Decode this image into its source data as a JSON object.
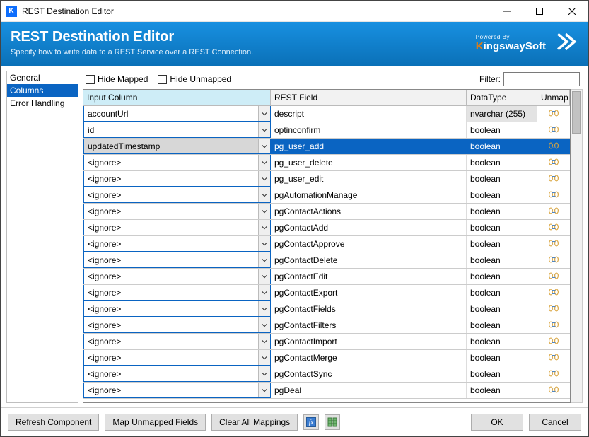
{
  "window": {
    "title": "REST Destination Editor"
  },
  "header": {
    "title": "REST Destination Editor",
    "subtitle": "Specify how to write data to a REST Service over a REST Connection.",
    "powered_by": "Powered By",
    "brand_k": "K",
    "brand_rest": "ingswaySoft"
  },
  "sidebar": {
    "items": [
      {
        "label": "General",
        "selected": false
      },
      {
        "label": "Columns",
        "selected": true
      },
      {
        "label": "Error Handling",
        "selected": false
      }
    ]
  },
  "toolbar": {
    "hide_mapped": "Hide Mapped",
    "hide_unmapped": "Hide Unmapped",
    "filter_label": "Filter:",
    "filter_value": ""
  },
  "grid": {
    "headers": {
      "input": "Input Column",
      "rest": "REST Field",
      "type": "DataType",
      "unmap": "Unmap"
    },
    "rows": [
      {
        "input": "accountUrl",
        "rest": "descript",
        "type": "nvarchar (255)",
        "type_shaded": true,
        "selected": false
      },
      {
        "input": "id",
        "rest": "optinconfirm",
        "type": "boolean",
        "selected": false
      },
      {
        "input": "updatedTimestamp",
        "rest": "pg_user_add",
        "type": "boolean",
        "selected": true
      },
      {
        "input": "<ignore>",
        "rest": "pg_user_delete",
        "type": "boolean",
        "selected": false
      },
      {
        "input": "<ignore>",
        "rest": "pg_user_edit",
        "type": "boolean",
        "selected": false
      },
      {
        "input": "<ignore>",
        "rest": "pgAutomationManage",
        "type": "boolean",
        "selected": false
      },
      {
        "input": "<ignore>",
        "rest": "pgContactActions",
        "type": "boolean",
        "selected": false
      },
      {
        "input": "<ignore>",
        "rest": "pgContactAdd",
        "type": "boolean",
        "selected": false
      },
      {
        "input": "<ignore>",
        "rest": "pgContactApprove",
        "type": "boolean",
        "selected": false
      },
      {
        "input": "<ignore>",
        "rest": "pgContactDelete",
        "type": "boolean",
        "selected": false
      },
      {
        "input": "<ignore>",
        "rest": "pgContactEdit",
        "type": "boolean",
        "selected": false
      },
      {
        "input": "<ignore>",
        "rest": "pgContactExport",
        "type": "boolean",
        "selected": false
      },
      {
        "input": "<ignore>",
        "rest": "pgContactFields",
        "type": "boolean",
        "selected": false
      },
      {
        "input": "<ignore>",
        "rest": "pgContactFilters",
        "type": "boolean",
        "selected": false
      },
      {
        "input": "<ignore>",
        "rest": "pgContactImport",
        "type": "boolean",
        "selected": false
      },
      {
        "input": "<ignore>",
        "rest": "pgContactMerge",
        "type": "boolean",
        "selected": false
      },
      {
        "input": "<ignore>",
        "rest": "pgContactSync",
        "type": "boolean",
        "selected": false
      },
      {
        "input": "<ignore>",
        "rest": "pgDeal",
        "type": "boolean",
        "selected": false
      }
    ]
  },
  "footer": {
    "refresh": "Refresh Component",
    "map_unmapped": "Map Unmapped Fields",
    "clear": "Clear All Mappings",
    "ok": "OK",
    "cancel": "Cancel"
  }
}
